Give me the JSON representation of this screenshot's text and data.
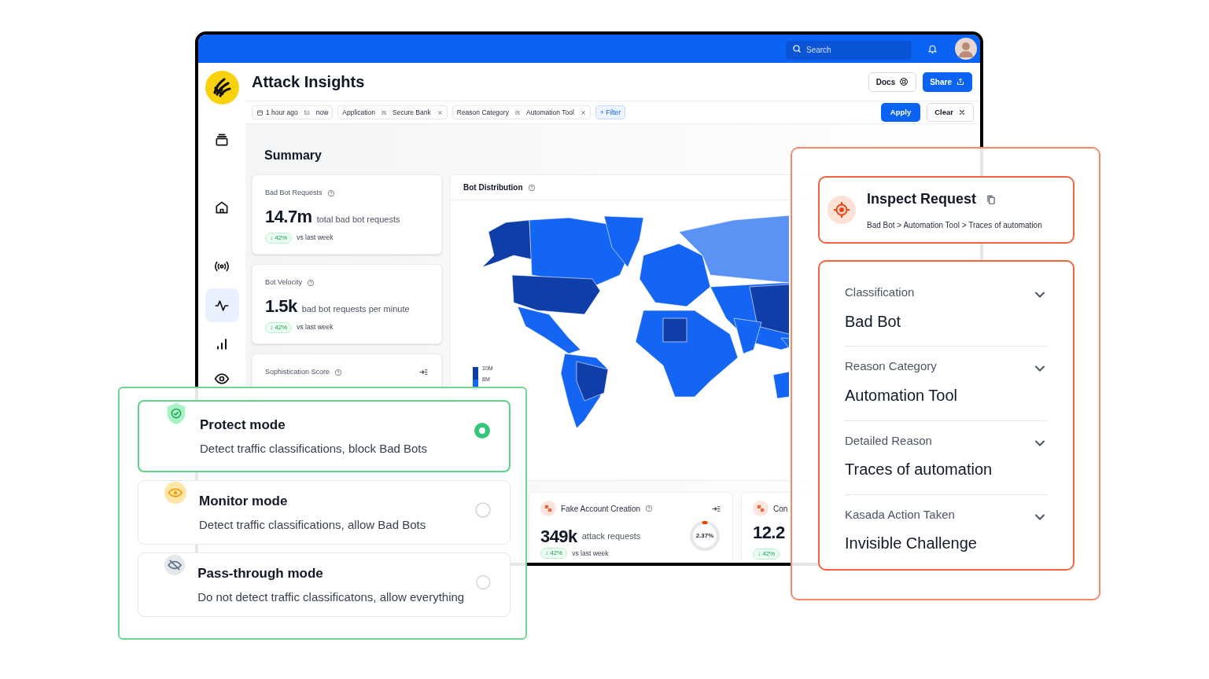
{
  "topbar": {
    "search": {
      "placeholder": "Search"
    }
  },
  "sidebar": {
    "items": [
      {
        "kind": "layers",
        "selected": false
      },
      {
        "kind": "home",
        "selected": false
      },
      {
        "kind": "broadcast",
        "selected": false
      },
      {
        "kind": "activity",
        "selected": true
      },
      {
        "kind": "chart",
        "selected": false
      },
      {
        "kind": "eye",
        "selected": false
      }
    ]
  },
  "page": {
    "title": "Attack Insights",
    "buttons": [
      {
        "label": "Docs",
        "kind": "secondary"
      },
      {
        "label": "Share",
        "kind": "primary"
      }
    ]
  },
  "filters": {
    "time": {
      "from": "1 hour ago",
      "joiner": "to",
      "to": "now"
    },
    "chips": [
      {
        "field": "Application",
        "op": "is",
        "value": "Secure Bank"
      },
      {
        "field": "Reason Category",
        "op": "is",
        "value": "Automation Tool"
      }
    ],
    "add": "+ Filter",
    "apply": "Apply",
    "clear": "Clear"
  },
  "summary": {
    "title": "Summary",
    "metrics": [
      {
        "label": "Bad Bot Requests",
        "value": "14.7m",
        "unit": "total bad bot requests",
        "change": "↓ 42%",
        "comparison": "vs last week"
      },
      {
        "label": "Bot Velocity",
        "value": "1.5k",
        "unit": "bad bot requests per minute",
        "change": "↓ 42%",
        "comparison": "vs last week"
      }
    ],
    "score": {
      "label": "Sophistication Score"
    }
  },
  "distribution": {
    "title": "Bot Distribution",
    "legend": [
      "10M",
      "8M"
    ]
  },
  "attack_cards": [
    {
      "label": "Fake Account Creation",
      "value": "349k",
      "unit": "attack requests",
      "change": "↓ 42%",
      "comparison": "vs last week",
      "share": "2.37%",
      "level": 0.0237
    },
    {
      "label": "Con",
      "value": "12.2",
      "change": "↓ 42%"
    }
  ],
  "inspect": {
    "title": "Inspect Request",
    "breadcrumb": "Bad Bot > Automation Tool > Traces of automation"
  },
  "details": [
    {
      "label": "Classification",
      "value": "Bad Bot"
    },
    {
      "label": "Reason Category",
      "value": "Automation Tool"
    },
    {
      "label": "Detailed Reason",
      "value": "Traces of automation"
    },
    {
      "label": "Kasada Action Taken",
      "value": "Invisible Challenge"
    }
  ],
  "modes": [
    {
      "kind": "protect",
      "title": "Protect mode",
      "description": "Detect traffic classifications, block Bad Bots",
      "selected": true
    },
    {
      "kind": "monitor",
      "title": "Monitor mode",
      "description": "Detect traffic classifications, allow Bad Bots",
      "selected": false
    },
    {
      "kind": "pass",
      "title": "Pass-through mode",
      "description": "Do not detect traffic classificatons, allow everything",
      "selected": false
    }
  ]
}
